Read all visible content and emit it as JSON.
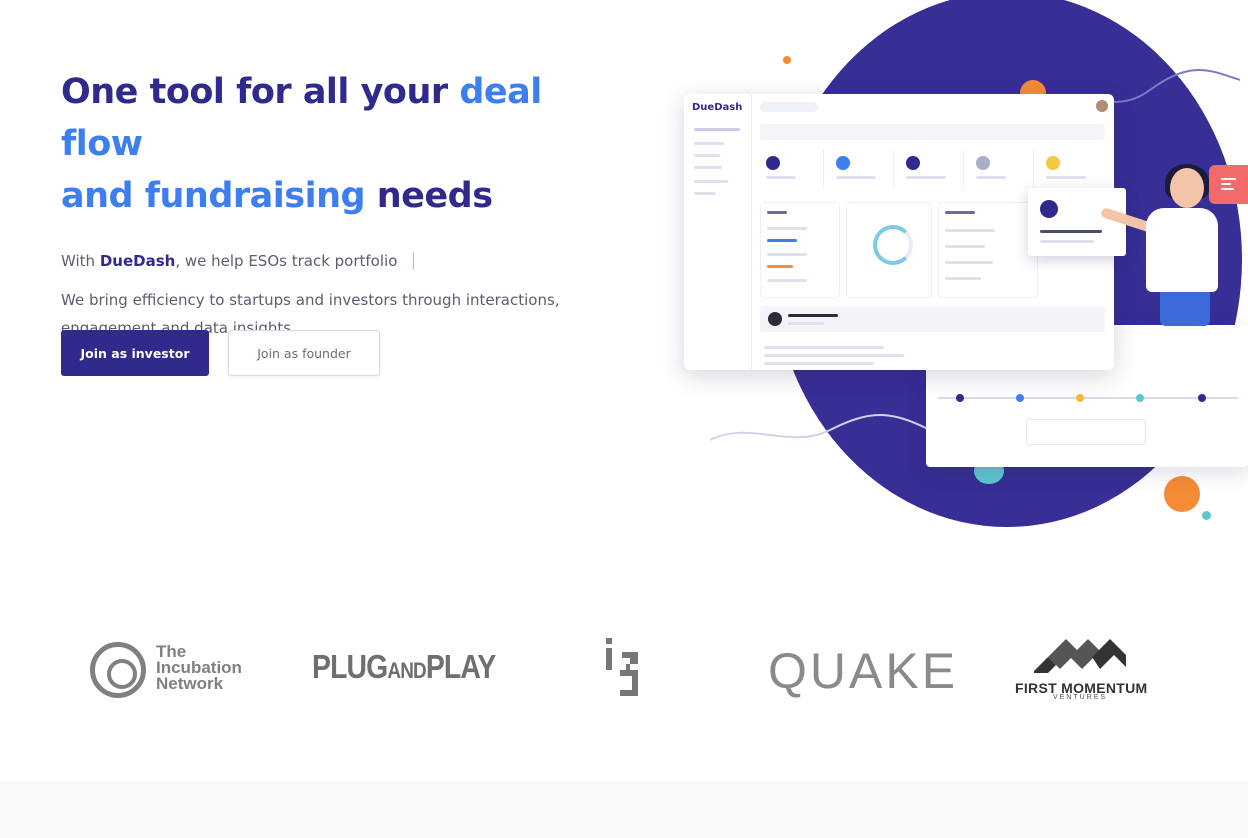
{
  "hero": {
    "title_part1": "One tool for all your ",
    "title_accent1": "deal flow",
    "title_accent2": "and fundraising",
    "title_part2": " needs",
    "intro_prefix": "With ",
    "intro_brand": "DueDash",
    "intro_suffix": ", we help ESOs track portfolio",
    "description": "We bring efficiency to startups and investors through interactions, engagement and data insights."
  },
  "buttons": {
    "investor_label": "Join as investor",
    "founder_label": "Join as founder"
  },
  "logos": {
    "incubation_line1": "The",
    "incubation_line2": "Incubation",
    "incubation_line3": "Network",
    "plug_and_play_1": "PLUG",
    "plug_and_play_2": "AND",
    "plug_and_play_3": "PLAY",
    "quake": "QUAKE",
    "first_momentum": "FIRST MOMENTUM",
    "first_momentum_sub": "VENTURES"
  },
  "colors": {
    "brand": "#2f2a8c",
    "accent": "#3d7ef0",
    "circle": "#372e96",
    "menu": "#f26a6a",
    "orange": "#f58b35",
    "teal": "#5ec7cf"
  }
}
